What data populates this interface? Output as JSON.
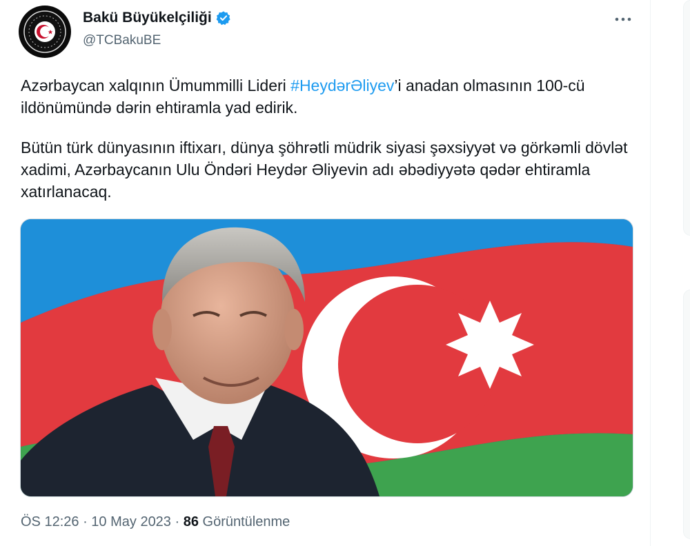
{
  "account": {
    "name": "Bakü Büyükelçiliği",
    "handle": "@TCBakuBE",
    "verified_icon": "verified-badge-icon",
    "avatar_icon": "embassy-seal-icon"
  },
  "tweet": {
    "para1_before": "Azərbaycan xalqının Ümummilli Lideri ",
    "hashtag": "#HeydərƏliyev",
    "para1_after": "’i anadan olmasının 100-cü ildönümündə dərin ehtiramla yad edirik.",
    "para2": "Bütün türk dünyasının iftixarı, dünya şöhrətli müdrik siyasi şəxsiyyət və görkəmli dövlət xadimi, Azərbaycanın Ulu Öndəri Heydər Əliyevin adı əbədiyyətə qədər ehtiramla xatırlanacaq."
  },
  "meta": {
    "time": "ÖS 12:26",
    "sep1": " · ",
    "date": "10 May 2023",
    "sep2": " · ",
    "views": "86",
    "views_label": "Görüntülenme"
  },
  "colors": {
    "link": "#1d9bf0",
    "verified": "#1d9bf0",
    "flag_blue": "#1e8fd9",
    "flag_red": "#e23a3f",
    "flag_green": "#3ea34f"
  }
}
